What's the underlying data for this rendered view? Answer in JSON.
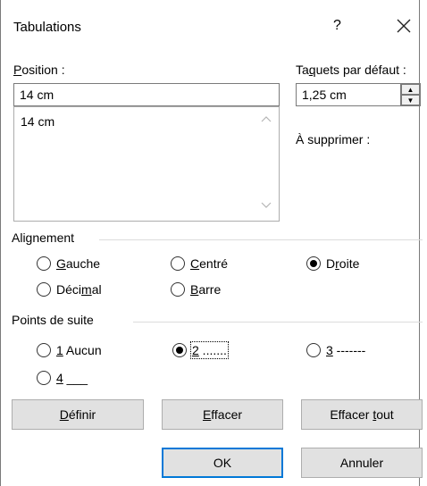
{
  "dialog": {
    "title": "Tabulations",
    "help_label": "?"
  },
  "position": {
    "label_first": "P",
    "label_rest": "osition :",
    "value": "14 cm",
    "list_items": [
      "14 cm"
    ]
  },
  "default_tabs": {
    "label_pre": "Ta",
    "label_u": "q",
    "label_post": "uets par défaut :",
    "value": "1,25 cm"
  },
  "to_delete": {
    "label": "À supprimer :"
  },
  "alignment": {
    "heading": "Alignement",
    "options": [
      {
        "u": "G",
        "rest": "auche",
        "selected": false
      },
      {
        "u": "C",
        "rest": "entré",
        "selected": false
      },
      {
        "pre": "D",
        "u": "r",
        "rest": "oite",
        "selected": true
      },
      {
        "pre": "Déci",
        "u": "m",
        "rest": "al",
        "selected": false
      },
      {
        "u": "B",
        "rest": "arre",
        "selected": false
      }
    ]
  },
  "leader": {
    "heading": "Points de suite",
    "options": [
      {
        "u": "1",
        "rest": " Aucun",
        "selected": false
      },
      {
        "u": "2",
        "rest": " .......",
        "selected": true
      },
      {
        "u": "3",
        "rest": " -------",
        "selected": false
      },
      {
        "u": "4",
        "rest": " ___",
        "selected": false
      }
    ]
  },
  "buttons": {
    "define_u": "D",
    "define_rest": "éfinir",
    "clear_u": "E",
    "clear_rest": "ffacer",
    "clear_all_pre": "Effacer ",
    "clear_all_u": "t",
    "clear_all_rest": "out",
    "ok": "OK",
    "cancel": "Annuler"
  }
}
